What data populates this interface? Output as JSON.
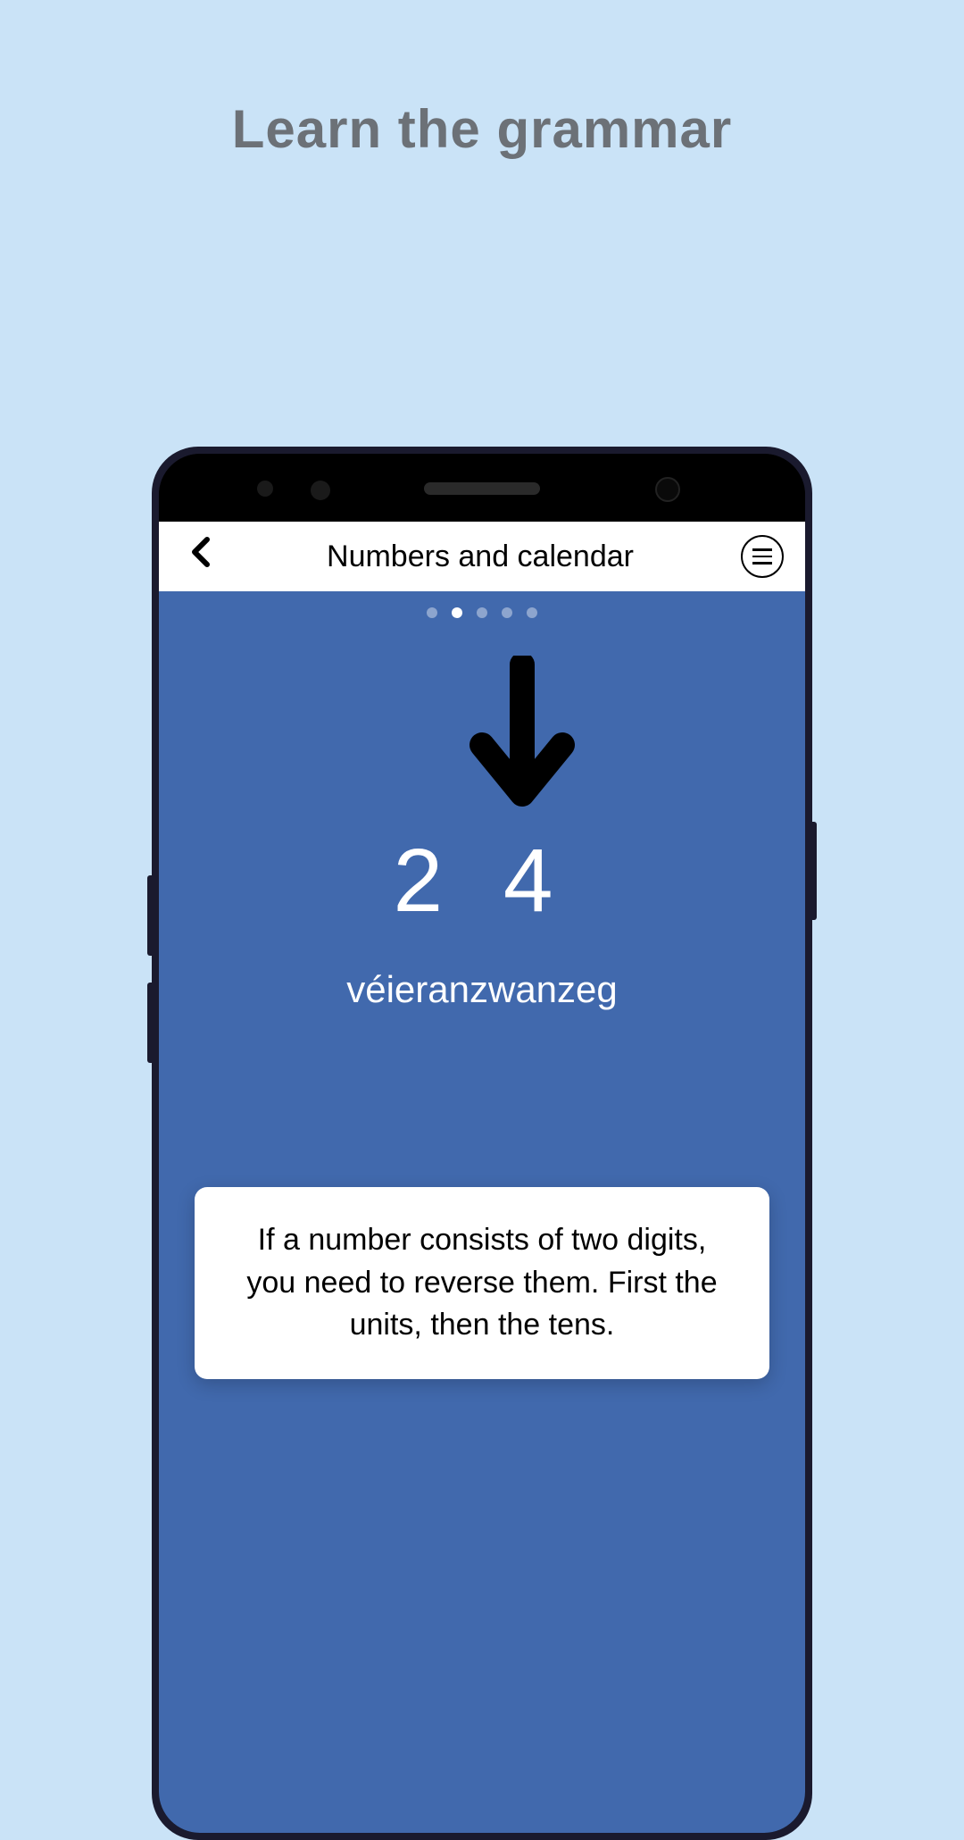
{
  "promo": {
    "heading": "Learn the grammar"
  },
  "app": {
    "header": {
      "title": "Numbers and calendar"
    },
    "pagination": {
      "total": 5,
      "active_index": 1
    },
    "content": {
      "number_display": "2 4",
      "word_display": "véieranzwanzeg",
      "explanation": "If a number consists of two digits, you need to reverse them. First the units, then the tens."
    }
  },
  "colors": {
    "background": "#cae3f7",
    "app_bg": "#4169ad",
    "card_bg": "#ffffff"
  }
}
